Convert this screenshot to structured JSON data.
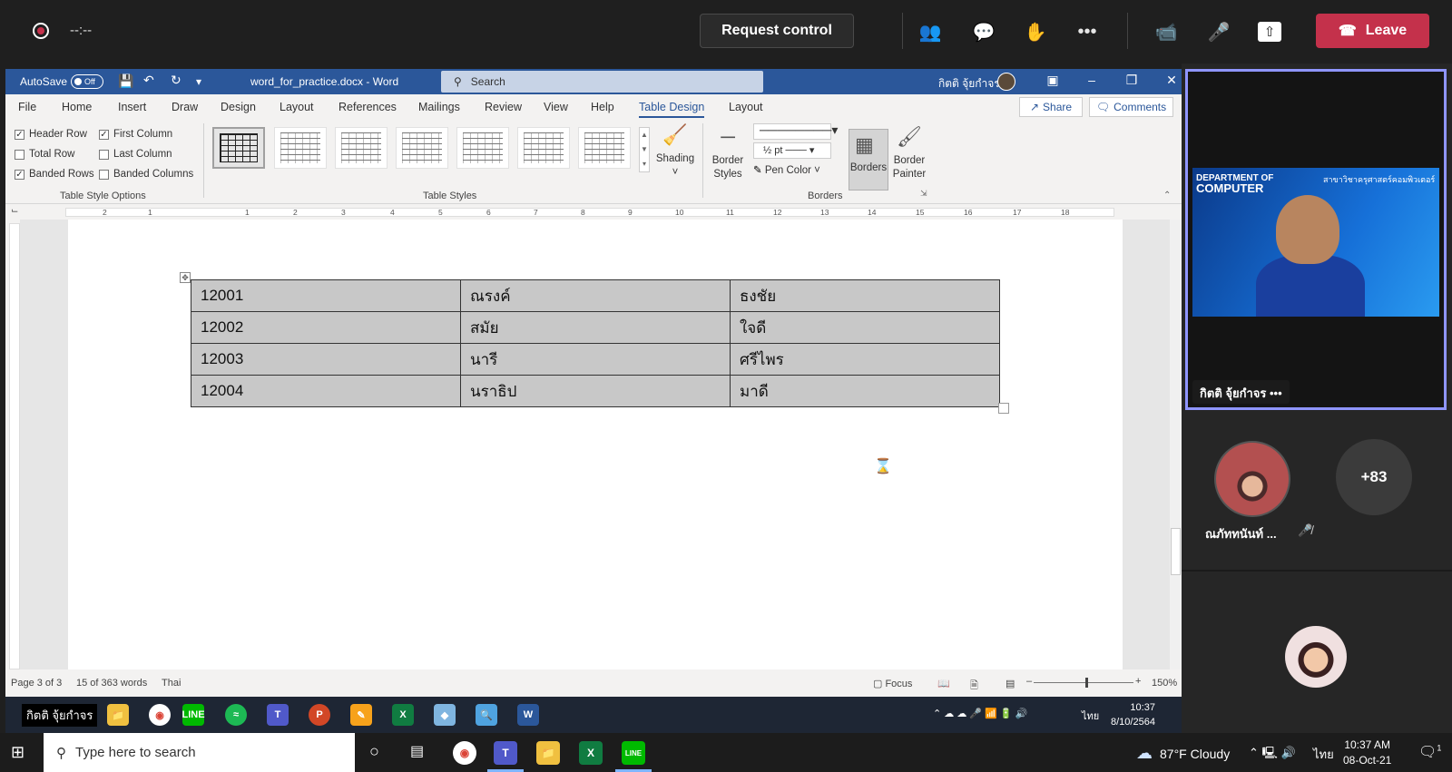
{
  "teams": {
    "recording_time": "--:--",
    "request_control": "Request control",
    "leave": "Leave",
    "icons": [
      "people-icon",
      "chat-icon",
      "raise-hand-icon",
      "more-icon",
      "camera-off-icon",
      "mic-off-icon",
      "share-tray-icon"
    ]
  },
  "word": {
    "autosave_label": "AutoSave",
    "autosave_state": "Off",
    "doc_title": "word_for_practice.docx  -  Word",
    "search_placeholder": "Search",
    "user_name": "กิตติ จุ้ยกำจร",
    "menu": [
      "File",
      "Home",
      "Insert",
      "Draw",
      "Design",
      "Layout",
      "References",
      "Mailings",
      "Review",
      "View",
      "Help",
      "Table Design",
      "Layout"
    ],
    "active_menu": "Table Design",
    "share": "Share",
    "comments": "Comments",
    "style_options": {
      "header_row": "Header Row",
      "first_column": "First Column",
      "total_row": "Total Row",
      "last_column": "Last Column",
      "banded_rows": "Banded Rows",
      "banded_columns": "Banded Columns",
      "group_label": "Table Style Options"
    },
    "table_styles_label": "Table Styles",
    "shading": "Shading",
    "border_styles": "Border Styles",
    "pen_weight": "½ pt",
    "pen_color": "Pen Color",
    "borders": "Borders",
    "border_painter": "Border Painter",
    "borders_group_label": "Borders",
    "ruler_numbers": [
      "2",
      "1",
      "1",
      "2",
      "3",
      "4",
      "5",
      "6",
      "7",
      "8",
      "9",
      "10",
      "11",
      "12",
      "13",
      "14",
      "15",
      "16",
      "17",
      "18"
    ],
    "table_rows": [
      [
        "12001",
        "ณรงค์",
        "ธงชัย"
      ],
      [
        "12002",
        "สมัย",
        "ใจดี"
      ],
      [
        "12003",
        "นารี",
        "ศรีไพร"
      ],
      [
        "12004",
        "นราธิป",
        "มาดี"
      ]
    ],
    "status": {
      "page": "Page 3 of 3",
      "words": "15 of 363 words",
      "language": "Thai",
      "focus": "Focus",
      "zoom": "150%"
    }
  },
  "inner_taskbar": {
    "label": "กิตติ จุ้ยกำจร",
    "time": "10:37",
    "date": "8/10/2564",
    "lang": "ไทย"
  },
  "right_panel": {
    "presenter_name": "กิตติ จุ้ยกำจร",
    "video_logo_line1": "DEPARTMENT OF",
    "video_logo_line2": "COMPUTER",
    "video_banner": "สาขาวิชาครุศาสตร์คอมพิวเตอร์",
    "participant1": "ณภัททนันท์ ...",
    "more_count": "+83"
  },
  "windows": {
    "search_placeholder": "Type here to search",
    "weather": "87°F  Cloudy",
    "lang": "ไทย",
    "time": "10:37 AM",
    "date": "08-Oct-21",
    "notif_count": "1"
  }
}
